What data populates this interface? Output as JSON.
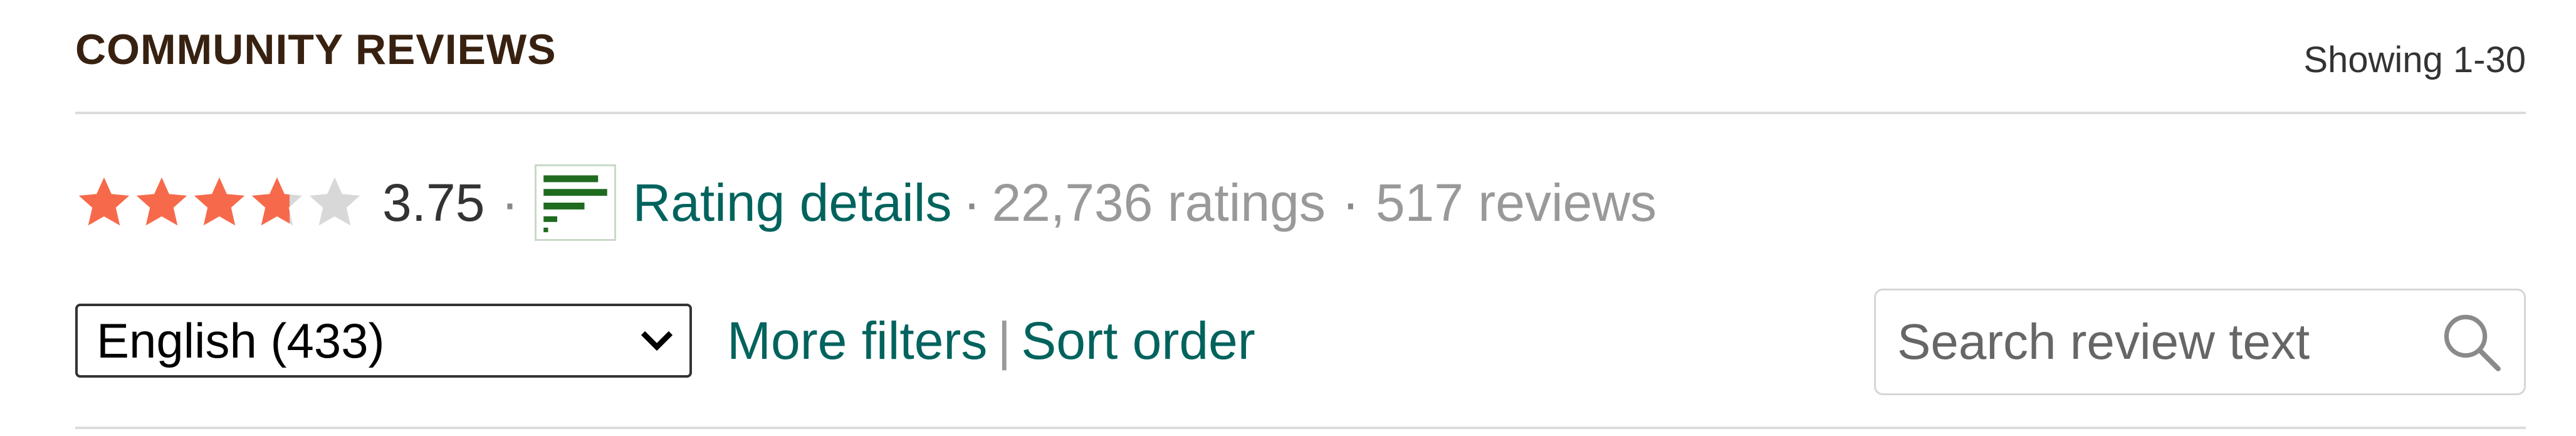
{
  "header": {
    "title": "COMMUNITY REVIEWS",
    "showing": "Showing 1-30"
  },
  "rating": {
    "stars_filled": 3.75,
    "stars_total": 5,
    "star_color": "#f66a4b",
    "star_empty_color": "#d8d8d8",
    "average": "3.75",
    "separator": "·",
    "details_label": "Rating details",
    "ratings_count": "22,736 ratings",
    "reviews_count": "517 reviews",
    "histogram_icon": "bar-chart-icon",
    "histogram_color": "#1f6b1f"
  },
  "filters": {
    "language_selected": "English (433)",
    "more_filters_label": "More filters",
    "divider": "|",
    "sort_order_label": "Sort order"
  },
  "search": {
    "placeholder": "Search review text",
    "icon": "magnifier-icon"
  },
  "colors": {
    "link": "#00635d",
    "heading": "#382110",
    "muted": "#999999"
  }
}
